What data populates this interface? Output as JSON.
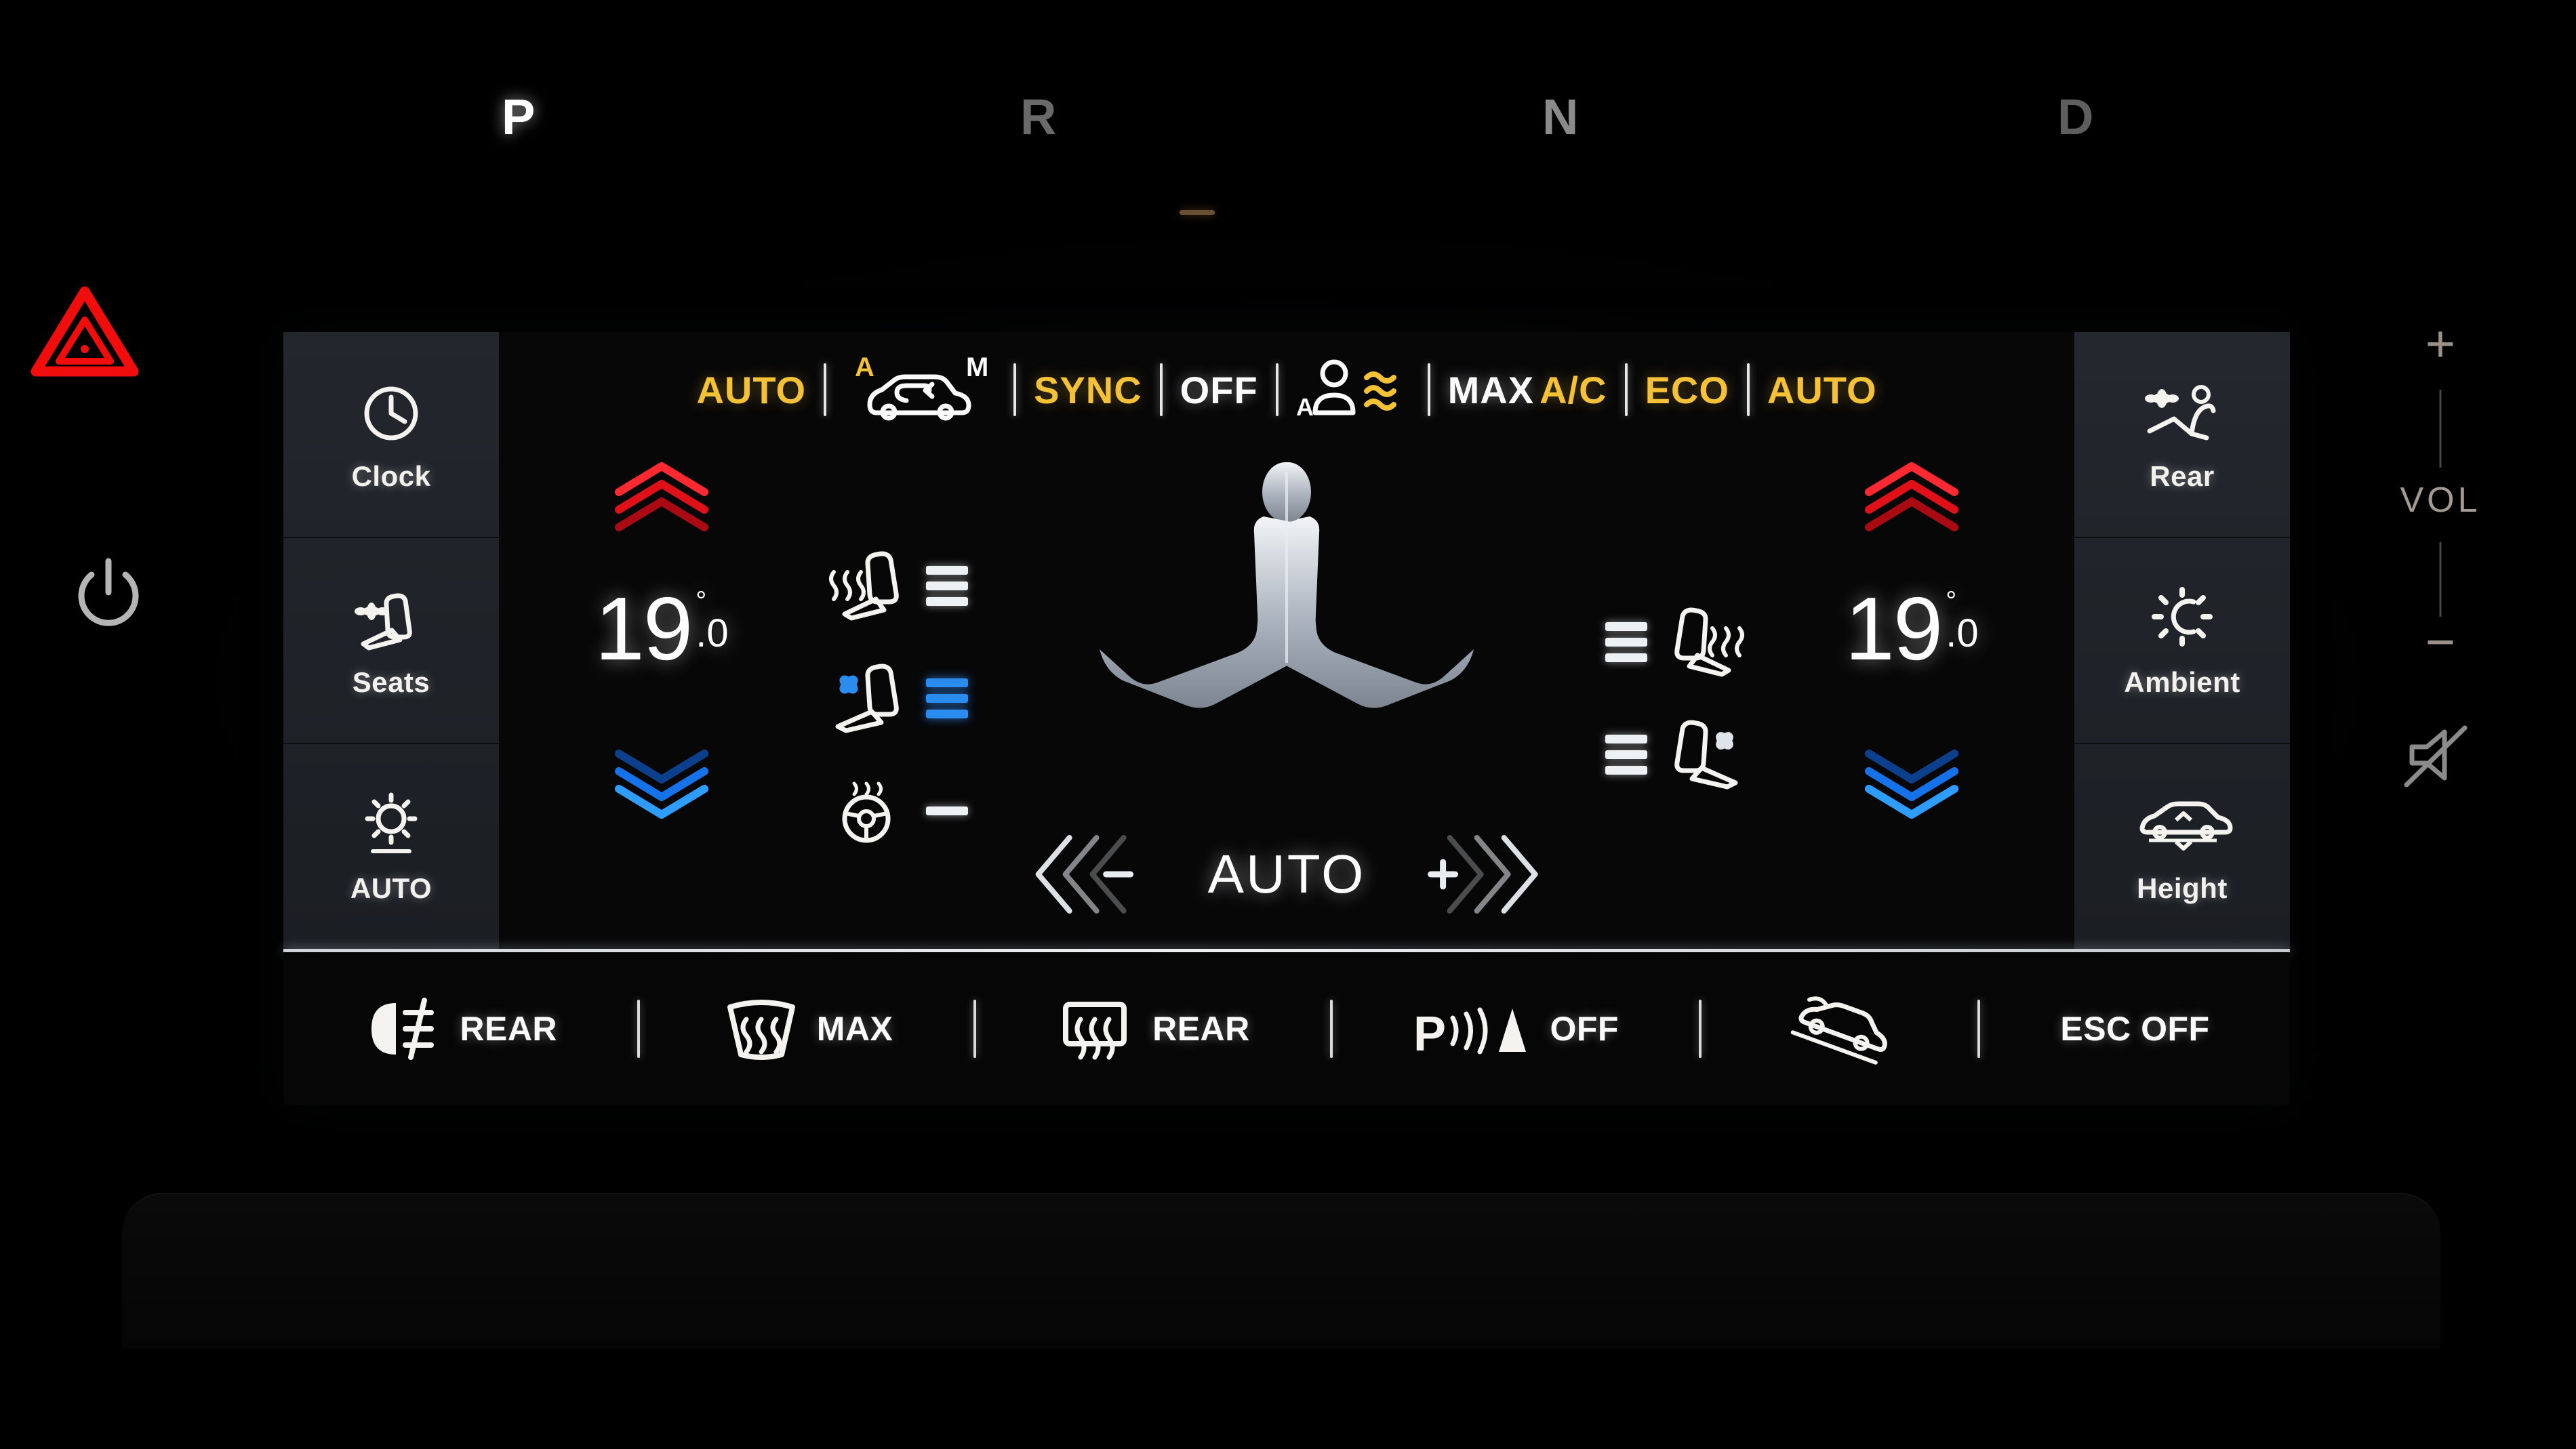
{
  "gear_indicator": {
    "positions": [
      {
        "letter": "P",
        "active": true
      },
      {
        "letter": "R",
        "active": false
      },
      {
        "letter": "N",
        "active": false
      },
      {
        "letter": "D",
        "active": false
      }
    ]
  },
  "hard_keys": {
    "hazard": {
      "name": "hazard-warning",
      "color": "#f20d0d"
    },
    "power": {
      "name": "power",
      "color": "#b5b5b5"
    },
    "volume": {
      "label": "VOL",
      "increase": "+",
      "decrease": "−"
    },
    "mute": {
      "name": "mute"
    }
  },
  "sidebar_left": {
    "items": [
      {
        "label": "Clock",
        "icon": "clock-icon"
      },
      {
        "label": "Seats",
        "icon": "seat-fan-icon"
      },
      {
        "label": "AUTO",
        "icon": "brightness-auto-icon"
      }
    ]
  },
  "sidebar_right": {
    "items": [
      {
        "label": "Rear",
        "icon": "rear-seat-climate-icon"
      },
      {
        "label": "Ambient",
        "icon": "ambient-light-icon"
      },
      {
        "label": "Height",
        "icon": "vehicle-height-icon"
      }
    ]
  },
  "toolbar": {
    "items": [
      {
        "type": "text",
        "label": "AUTO",
        "state": "on",
        "color": "#f5c237",
        "name": "auto-climate-button"
      },
      {
        "type": "sep"
      },
      {
        "type": "recirc",
        "label_a": "A",
        "label_m": "M",
        "a_color": "#f5c237",
        "m_color": "#fbfbfb",
        "name": "air-recirculation-button"
      },
      {
        "type": "sep"
      },
      {
        "type": "text",
        "label": "SYNC",
        "state": "on",
        "color": "#f5c237",
        "name": "sync-button"
      },
      {
        "type": "sep"
      },
      {
        "type": "text",
        "label": "OFF",
        "state": "off",
        "color": "#fbfbfb",
        "name": "climate-off-button"
      },
      {
        "type": "sep"
      },
      {
        "type": "ionizer",
        "label_a": "A",
        "name": "air-quality-ionizer-button"
      },
      {
        "type": "sep"
      },
      {
        "type": "maxac",
        "label_max": "MAX",
        "label_ac": "A/C",
        "max_color": "#fbfbfb",
        "ac_color": "#f5c237",
        "name": "max-ac-button"
      },
      {
        "type": "sep"
      },
      {
        "type": "text",
        "label": "ECO",
        "state": "on",
        "color": "#f5c237",
        "name": "eco-button"
      },
      {
        "type": "sep"
      },
      {
        "type": "text",
        "label": "AUTO",
        "state": "on",
        "color": "#f5c237",
        "name": "auto-defog-button"
      }
    ]
  },
  "climate": {
    "left_zone": {
      "temperature_int": "19",
      "temperature_frac": ".0",
      "degree_symbol": "°",
      "up_color": "#e8141c",
      "down_color": "#1572e8",
      "name": "driver-temperature"
    },
    "right_zone": {
      "temperature_int": "19",
      "temperature_frac": ".0",
      "degree_symbol": "°",
      "up_color": "#e8141c",
      "down_color": "#1572e8",
      "name": "passenger-temperature"
    },
    "left_seat_controls": [
      {
        "icon": "seat-heater-icon",
        "level": 3,
        "bar_color": "white",
        "name": "driver-seat-heater"
      },
      {
        "icon": "seat-ventilation-icon",
        "level": 3,
        "bar_color": "blue",
        "name": "driver-seat-ventilation"
      },
      {
        "icon": "steering-wheel-heater-icon",
        "level": 1,
        "bar_color": "white",
        "name": "steering-wheel-heater"
      }
    ],
    "right_seat_controls": [
      {
        "icon": "seat-heater-icon",
        "level": 3,
        "bar_color": "white",
        "name": "passenger-seat-heater"
      },
      {
        "icon": "seat-ventilation-icon",
        "level": 3,
        "bar_color": "white",
        "name": "passenger-seat-ventilation"
      }
    ],
    "fan": {
      "mode_label": "AUTO",
      "decrease_label": "−",
      "increase_label": "+",
      "name": "fan-speed-control"
    },
    "airflow_graphic": "two-seated-occupants-airflow"
  },
  "bottom_bar": {
    "items": [
      {
        "icon": "rear-fog-light-icon",
        "label": "REAR",
        "name": "rear-fog-light-button"
      },
      {
        "type": "sep"
      },
      {
        "icon": "windshield-defrost-icon",
        "label": "MAX",
        "name": "windshield-defrost-button"
      },
      {
        "type": "sep"
      },
      {
        "icon": "rear-defrost-icon",
        "label": "REAR",
        "name": "rear-defrost-button"
      },
      {
        "type": "sep"
      },
      {
        "icon": "park-assist-icon",
        "label": "OFF",
        "prefix": "P",
        "name": "park-assist-button"
      },
      {
        "type": "sep"
      },
      {
        "icon": "hill-descent-icon",
        "label": "",
        "name": "hill-descent-button"
      },
      {
        "type": "sep"
      },
      {
        "icon": "",
        "label": "ESC OFF",
        "name": "esc-off-button"
      }
    ]
  }
}
